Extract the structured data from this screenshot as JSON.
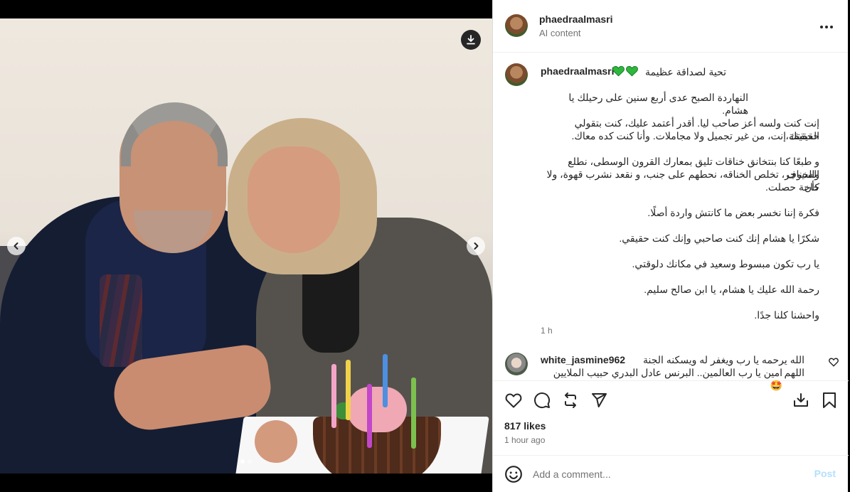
{
  "post": {
    "username": "phaedraalmasri",
    "subtitle": "AI content",
    "more_icon": "more-horizontal-icon"
  },
  "caption": {
    "username": "phaedraalmasri",
    "title": "تحية لصداقة عظيمة",
    "heart_color": "#2db83d",
    "lines": [
      "النهاردة الصبح عدى أربع سنين على رحيلك يا هشام.",
      "إنت كنت ولسه أعز صاحب ليا. أقدر أعتمد عليك، كنت بتقولي الحقيقة،",
      "حقيقتك إنت، من غير تجميل ولا مجاملات. وأنا كنت كده معاك.",
      "و طبعًا كنا بنتخانق خناقات تليق بمعارك القرون الوسطى، نطلع السيوف",
      "والخناجر، تخلص الخناقه، نحطهم على جنب، و نقعد نشرب قهوة، ولا كأن",
      "حاجة حصلت.",
      "فكرة إننا نخسر بعض ما كانتش واردة أصلًا.",
      "شكرًا يا هشام إنك كنت صاحبي وإنك كنت حقيقي.",
      "يا رب تكون مبسوط وسعيد في مكانك دلوقتي.",
      "رحمة الله عليك يا هشام، يا ابن صالح سليم.",
      "واحشنا كلنا جدًا."
    ],
    "time": "1 h"
  },
  "comment": {
    "username": "white_jasmine962",
    "text_line1": "الله يرحمه يا رب ويغفر له ويسكنه الجنة اللهم",
    "text_line2": "امين يا رب العالمين.. البرنس عادل البدري حبيب الملايين 🤩"
  },
  "actions": {
    "like_icon": "heart-icon",
    "comment_icon": "comment-icon",
    "share_icon": "repost-icon",
    "send_icon": "send-icon",
    "save_icon": "bookmark-icon",
    "download_icon": "download-icon"
  },
  "stats": {
    "likes": "817 likes",
    "ago": "1 hour ago"
  },
  "add_comment": {
    "placeholder": "Add a comment...",
    "post_label": "Post"
  },
  "carousel": {
    "slide_count": 2,
    "active_slide": 1
  },
  "colors": {
    "accent_disabled": "#b2dffc",
    "text": "#262626",
    "secondary": "#737373"
  }
}
